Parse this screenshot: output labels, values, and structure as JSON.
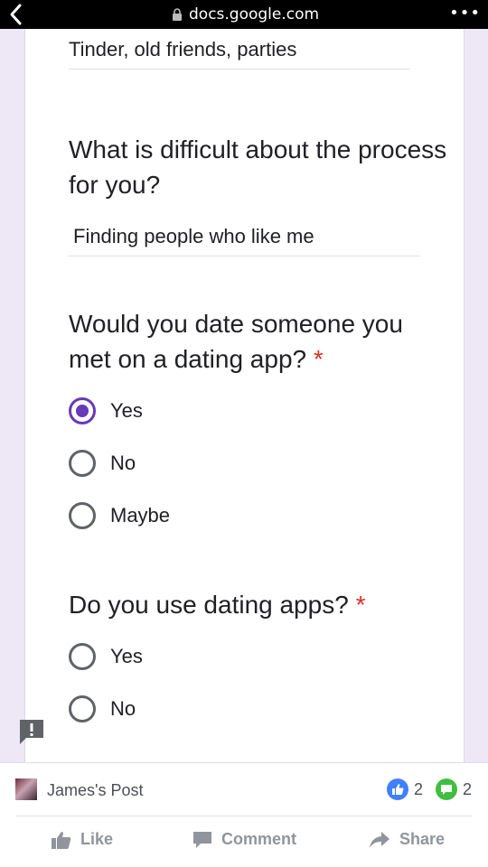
{
  "browser": {
    "url": "docs.google.com",
    "menu_glyph": "•••"
  },
  "form": {
    "prev_answer": "Tinder, old friends, parties",
    "q_difficult": {
      "text": "What is difficult about the process for you?",
      "answer": "Finding people who like me"
    },
    "q_date": {
      "text": "Would you date someone you met on a dating app?",
      "required": "*",
      "options": [
        "Yes",
        "No",
        "Maybe"
      ],
      "selected": "Yes"
    },
    "q_use": {
      "text": "Do you use dating apps?",
      "required": "*",
      "options": [
        "Yes",
        "No"
      ]
    }
  },
  "facebook": {
    "post_title": "James's Post",
    "like_count": "2",
    "comment_count": "2",
    "actions": {
      "like": "Like",
      "comment": "Comment",
      "share": "Share"
    }
  },
  "colors": {
    "accent": "#673ab7",
    "required": "#d93025",
    "fb_like": "#4080ff",
    "fb_comment": "#3fbf3f"
  }
}
